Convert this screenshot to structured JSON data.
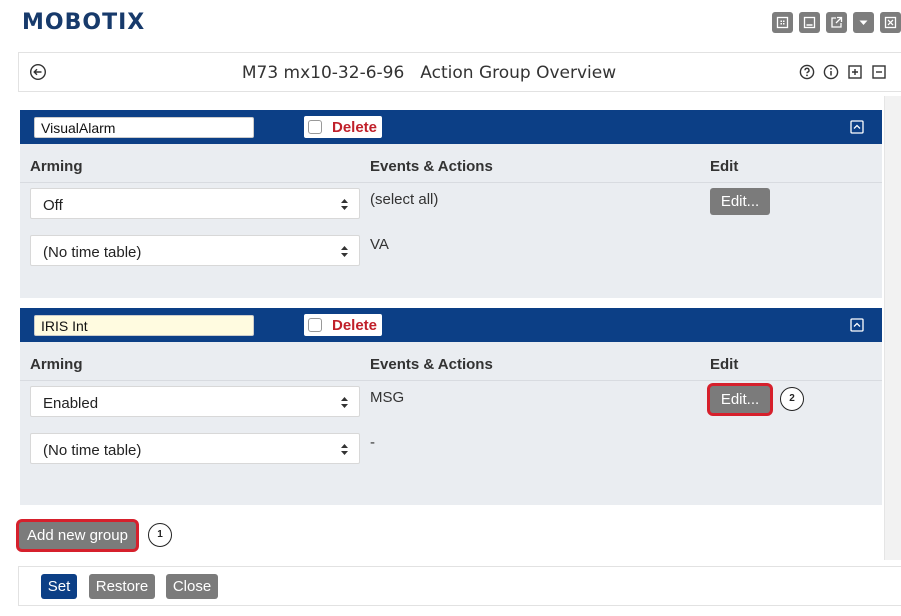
{
  "brand": {
    "logo": "MOBOTIX"
  },
  "window_icons": [
    "grid-icon",
    "minimize-icon",
    "popout-icon",
    "dropdown-icon",
    "close-icon"
  ],
  "title_bar": {
    "device": "M73 mx10-32-6-96",
    "title": "Action Group Overview",
    "tools": [
      "help-icon",
      "info-icon",
      "expand-all-icon",
      "collapse-all-icon"
    ]
  },
  "columns": {
    "arming": "Arming",
    "events": "Events & Actions",
    "edit": "Edit"
  },
  "groups": [
    {
      "name": "VisualAlarm",
      "delete_label": "Delete",
      "arming_value": "Off",
      "timetable_value": "(No time table)",
      "events_line1": "(select all)",
      "events_line2": "VA",
      "edit_label": "Edit..."
    },
    {
      "name": "IRIS Int",
      "delete_label": "Delete",
      "arming_value": "Enabled",
      "timetable_value": "(No time table)",
      "events_line1": "MSG",
      "events_line2": "-",
      "edit_label": "Edit...",
      "callout": "2"
    }
  ],
  "add_group": {
    "label": "Add new group",
    "callout": "1"
  },
  "footer": {
    "set": "Set",
    "restore": "Restore",
    "close": "Close"
  },
  "colors": {
    "brand": "#173a6b",
    "header_bg": "#0c3f86",
    "delete_text": "#c0202a",
    "highlight": "#d6202c",
    "button_grey": "#7b7b7b"
  }
}
